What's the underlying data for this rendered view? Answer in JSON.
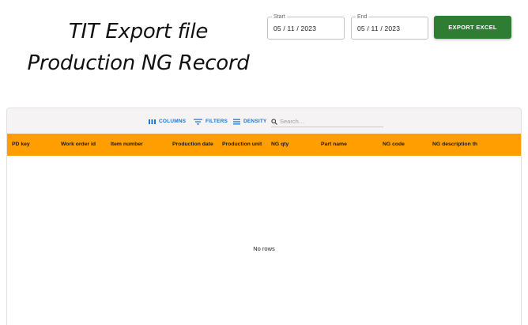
{
  "title": {
    "line1": "TIT Export file",
    "line2": "Production NG Record"
  },
  "filters": {
    "start": {
      "label": "Start",
      "value": "05 / 11 / 2023"
    },
    "end": {
      "label": "End",
      "value": "05 / 11 / 2023"
    }
  },
  "export_button": {
    "label": "EXPORT EXCEL",
    "color": "#2e7d32"
  },
  "toolbar": {
    "columns_label": "COLUMNS",
    "filters_label": "FILTERS",
    "density_label": "DENSITY",
    "search_placeholder": "Search…",
    "accent_color": "#1976d2"
  },
  "table": {
    "header_color": "#ff9e00",
    "columns": [
      "PD key",
      "Work order id",
      "Item number",
      "Production date",
      "Production unit",
      "NG qty",
      "Part name",
      "NG code",
      "NG description th"
    ],
    "empty_message": "No rows"
  }
}
